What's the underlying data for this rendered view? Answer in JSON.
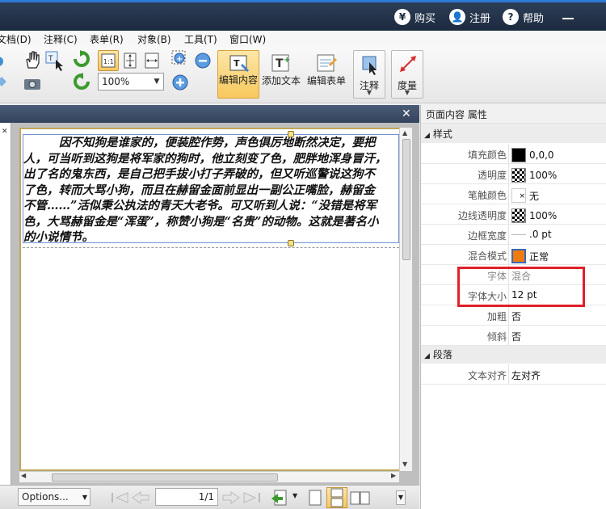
{
  "topbar": {
    "buy_label": "购买",
    "register_label": "注册",
    "help_label": "帮助"
  },
  "menu": {
    "items": [
      "文档(D)",
      "注释(C)",
      "表单(R)",
      "对象(B)",
      "工具(T)",
      "窗口(W)"
    ]
  },
  "toolbar": {
    "zoom_value": "100%",
    "edit_content_label": "编辑内容",
    "add_text_label": "添加文本",
    "edit_form_label": "编辑表单",
    "annotate_label": "注释",
    "measure_label": "度量",
    "actual_size_label": "1:1"
  },
  "document": {
    "lines": [
      "因不知狗是谁家的，便装腔作势，声色俱厉地断然决定，要把",
      "人，可当听到这狗是将军家的狗时，他立刻变了色，肥胖地浑身冒汗，",
      "出了名的鬼东西，是自己把手拔小打子弄破的，但又听巡警说这狗不",
      "了色，转而大骂小狗，而且在赫留金面前显出一副公正嘴脸，赫留金",
      "不管……”活似秉公执法的青天大老爷。可又听到人说：“没错是将军",
      "色，大骂赫留金是“浑蛋”，称赞小狗是“名贵”的动物。这就是著名小",
      "的小说情节。"
    ]
  },
  "bottombar": {
    "options_label": "Options...",
    "page_indicator": "1/1"
  },
  "properties": {
    "title": "页面内容 属性",
    "style_section": "样式",
    "paragraph_section": "段落",
    "rows": [
      {
        "label": "填充颜色",
        "value": "0,0,0"
      },
      {
        "label": "透明度",
        "value": "100%"
      },
      {
        "label": "笔触颜色",
        "value": "无"
      },
      {
        "label": "边线透明度",
        "value": "100%"
      },
      {
        "label": "边框宽度",
        "value": ".0 pt"
      },
      {
        "label": "混合模式",
        "value": "正常"
      },
      {
        "label": "字体",
        "value": "混合"
      },
      {
        "label": "字体大小",
        "value": "12 pt"
      },
      {
        "label": "加粗",
        "value": "否"
      },
      {
        "label": "倾斜",
        "value": "否"
      }
    ],
    "paragraph_rows": [
      {
        "label": "文本对齐",
        "value": "左对齐"
      }
    ]
  },
  "colors": {
    "accent": "#2f7bd6",
    "highlight": "#e0202a",
    "fill_swatch": "#000000",
    "blend_swatch": "#f07c10"
  }
}
